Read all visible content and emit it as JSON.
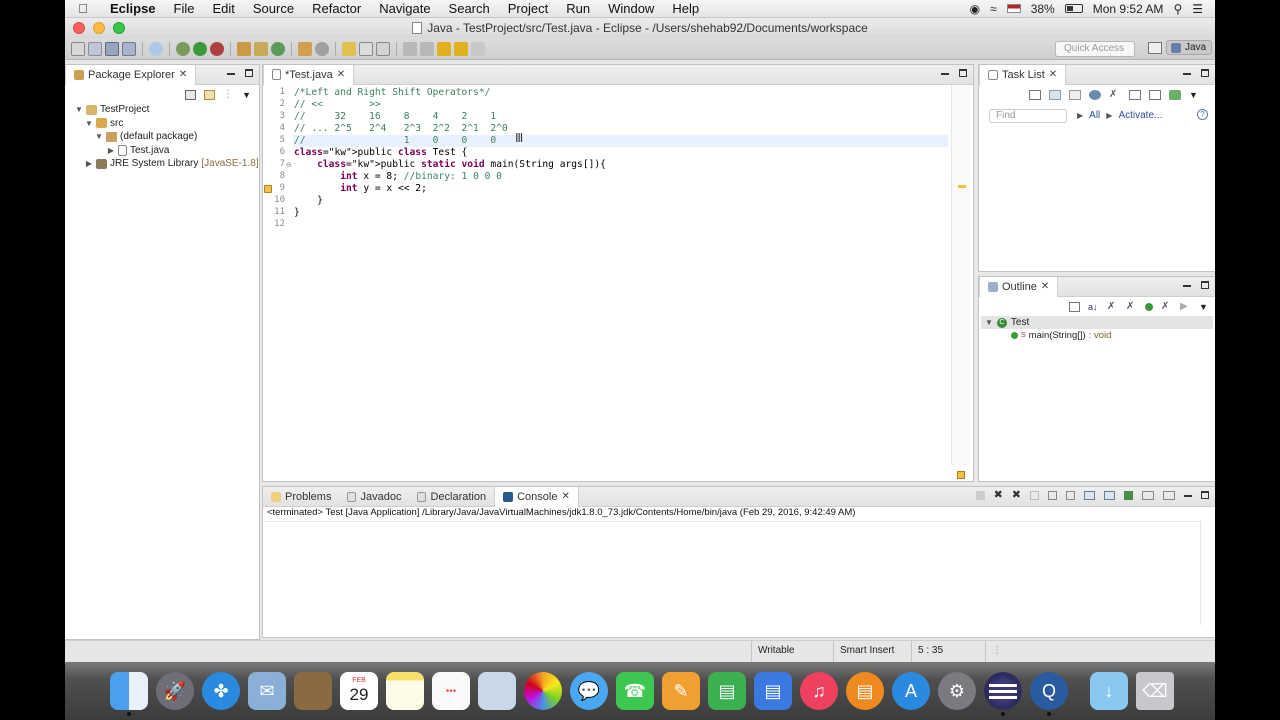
{
  "menubar": {
    "app_name": "Eclipse",
    "items": [
      "File",
      "Edit",
      "Source",
      "Refactor",
      "Navigate",
      "Search",
      "Project",
      "Run",
      "Window",
      "Help"
    ],
    "battery": "38%",
    "clock": "Mon 9:52 AM"
  },
  "window": {
    "title": "Java - TestProject/src/Test.java - Eclipse - /Users/shehab92/Documents/workspace"
  },
  "toolbar": {
    "quick_access_placeholder": "Quick Access",
    "perspective": "Java"
  },
  "package_explorer": {
    "tab": "Package Explorer",
    "tree": {
      "project": "TestProject",
      "src": "src",
      "package": "(default package)",
      "file": "Test.java",
      "library": "JRE System Library",
      "library_version": "[JavaSE-1.8]"
    }
  },
  "editor": {
    "tab": "*Test.java",
    "lines": [
      {
        "num": "1",
        "text": "/*Left and Right Shift Operators*/",
        "style": "cmt"
      },
      {
        "num": "2",
        "text": "// <<        >>",
        "style": "cmt"
      },
      {
        "num": "3",
        "text": "//     32    16    8    4    2    1",
        "style": "cmt"
      },
      {
        "num": "4",
        "text": "// ... 2^5   2^4   2^3  2^2  2^1  2^0",
        "style": "cmt"
      },
      {
        "num": "5",
        "text": "//                 1    0    0    0",
        "style": "cmt"
      },
      {
        "num": "6",
        "text": "public class Test {",
        "style": "code"
      },
      {
        "num": "7",
        "text": "    public static void main(String args[]){",
        "style": "code"
      },
      {
        "num": "8",
        "text": "        int x = 8; //binary: 1 0 0 0",
        "style": "code"
      },
      {
        "num": "9",
        "text": "        int y = x << 2;",
        "style": "code"
      },
      {
        "num": "10",
        "text": "    }",
        "style": "code"
      },
      {
        "num": "11",
        "text": "}",
        "style": "code"
      },
      {
        "num": "12",
        "text": "",
        "style": "code"
      }
    ]
  },
  "task_list": {
    "tab": "Task List",
    "find_placeholder": "Find",
    "all_label": "All",
    "activate_label": "Activate..."
  },
  "outline": {
    "tab": "Outline",
    "class_name": "Test",
    "method": "main(String[])",
    "method_type": ": void"
  },
  "bottom_panel": {
    "tabs": [
      "Problems",
      "Javadoc",
      "Declaration",
      "Console"
    ],
    "active_tab": "Console",
    "console_text": "<terminated> Test [Java Application] /Library/Java/JavaVirtualMachines/jdk1.8.0_73.jdk/Contents/Home/bin/java (Feb 29, 2016, 9:42:49 AM)"
  },
  "statusbar": {
    "writable": "Writable",
    "insert_mode": "Smart Insert",
    "position": "5 : 35"
  },
  "dock": {
    "calendar_month": "FEB",
    "calendar_day": "29"
  },
  "colors": {
    "comment": "#3f7f5f",
    "keyword": "#7f0055",
    "current_line": "#e8f2fe",
    "link": "#2b4f9e"
  }
}
